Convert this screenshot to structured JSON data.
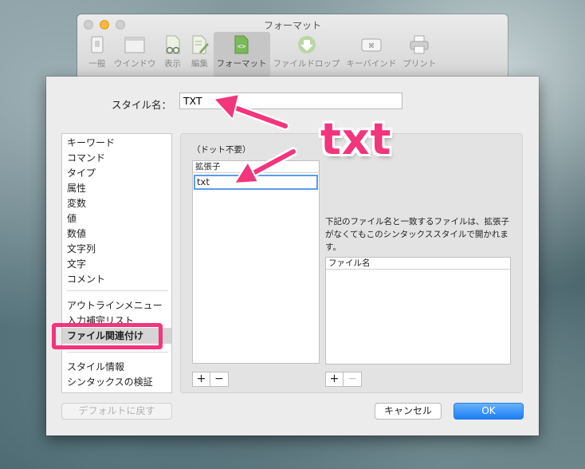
{
  "window": {
    "title": "フォーマット"
  },
  "toolbar": {
    "items": [
      {
        "label": "一般",
        "icon": "switch-icon"
      },
      {
        "label": "ウインドウ",
        "icon": "window-icon"
      },
      {
        "label": "表示",
        "icon": "document-glasses-icon"
      },
      {
        "label": "編集",
        "icon": "document-pencil-icon"
      },
      {
        "label": "フォーマット",
        "icon": "code-document-icon",
        "active": true
      },
      {
        "label": "ファイルドロップ",
        "icon": "drop-arrow-icon"
      },
      {
        "label": "キーバインド",
        "icon": "command-key-icon"
      },
      {
        "label": "プリント",
        "icon": "printer-icon"
      }
    ]
  },
  "style_name": {
    "label": "スタイル名：",
    "value": "TXT"
  },
  "categories": {
    "group1": [
      "キーワード",
      "コマンド",
      "タイプ",
      "属性",
      "変数",
      "値",
      "数値",
      "文字列",
      "文字",
      "コメント"
    ],
    "group2": [
      "アウトラインメニュー",
      "入力補完リスト",
      "ファイル関連付け"
    ],
    "group3": [
      "スタイル情報",
      "シンタックスの検証"
    ],
    "selected": "ファイル関連付け"
  },
  "extensions": {
    "note": "（ドット不要）",
    "header": "拡張子",
    "values": [
      "txt"
    ]
  },
  "filenames": {
    "note": "下記のファイル名と一致するファイルは、拡張子がなくてもこのシンタックススタイルで開かれます。",
    "header": "ファイル名"
  },
  "buttons": {
    "add": "+",
    "remove": "−",
    "default": "デフォルトに戻す",
    "cancel": "キャンセル",
    "ok": "OK"
  },
  "annotation": {
    "callout": "txt",
    "color": "#f2357c"
  }
}
